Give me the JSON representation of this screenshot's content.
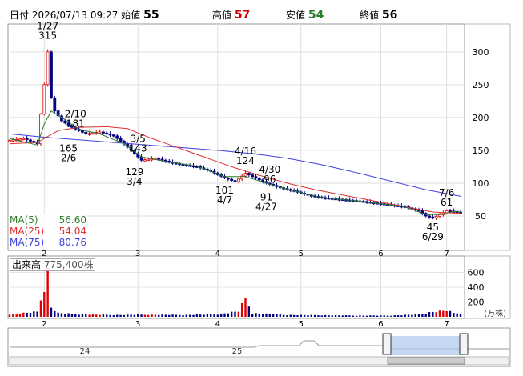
{
  "header": {
    "date_label": "日付",
    "date": "2026/07/13 09:27",
    "open_label": "始値",
    "open": "55",
    "high_label": "高値",
    "high": "57",
    "low_label": "安値",
    "low": "54",
    "close_label": "終値",
    "close": "56"
  },
  "legend": [
    {
      "name": "MA(5)",
      "value": "56.60",
      "color": "#2e7d2e"
    },
    {
      "name": "MA(25)",
      "value": "54.04",
      "color": "#e03030"
    },
    {
      "name": "MA(75)",
      "value": "80.76",
      "color": "#4040e0"
    }
  ],
  "volume": {
    "label": "出来高",
    "value": "775,400株",
    "unit": "(万株)",
    "ticks": [
      "600",
      "400",
      "200"
    ]
  },
  "navigator": {
    "labels": [
      "24",
      "25"
    ]
  },
  "colors": {
    "up": "#e00000",
    "down": "#000080",
    "ma5": "#2e7d2e",
    "ma25": "#e03030",
    "ma75": "#4040e0"
  },
  "chart_data": {
    "type": "candlestick",
    "y_ticks": [
      300,
      250,
      200,
      150,
      100,
      50
    ],
    "ylim": [
      0,
      340
    ],
    "x_months": [
      "2",
      "3",
      "4",
      "5",
      "6",
      "7"
    ],
    "annotations": [
      {
        "date": "1/27",
        "value": 315,
        "kind": "high"
      },
      {
        "date": "2/10",
        "value": 181,
        "kind": "high"
      },
      {
        "date": "2/6",
        "value": 165,
        "kind": "low"
      },
      {
        "date": "3/5",
        "value": 143,
        "kind": "high"
      },
      {
        "date": "3/4",
        "value": 129,
        "kind": "low"
      },
      {
        "date": "4/16",
        "value": 124,
        "kind": "high"
      },
      {
        "date": "4/7",
        "value": 101,
        "kind": "low"
      },
      {
        "date": "4/30",
        "value": 96,
        "kind": "high"
      },
      {
        "date": "4/27",
        "value": 91,
        "kind": "low"
      },
      {
        "date": "7/6",
        "value": 61,
        "kind": "high"
      },
      {
        "date": "6/29",
        "value": 45,
        "kind": "low"
      }
    ],
    "price_path": [
      [
        0,
        165
      ],
      [
        4,
        168
      ],
      [
        8,
        160
      ],
      [
        10,
        250
      ],
      [
        11,
        300
      ],
      [
        12,
        230
      ],
      [
        13,
        210
      ],
      [
        15,
        195
      ],
      [
        18,
        185
      ],
      [
        22,
        175
      ],
      [
        26,
        178
      ],
      [
        30,
        172
      ],
      [
        33,
        160
      ],
      [
        36,
        145
      ],
      [
        38,
        135
      ],
      [
        42,
        138
      ],
      [
        46,
        132
      ],
      [
        50,
        128
      ],
      [
        54,
        125
      ],
      [
        58,
        118
      ],
      [
        62,
        108
      ],
      [
        65,
        102
      ],
      [
        68,
        115
      ],
      [
        70,
        110
      ],
      [
        74,
        100
      ],
      [
        78,
        93
      ],
      [
        82,
        88
      ],
      [
        86,
        82
      ],
      [
        90,
        78
      ],
      [
        96,
        75
      ],
      [
        102,
        72
      ],
      [
        108,
        68
      ],
      [
        114,
        64
      ],
      [
        118,
        58
      ],
      [
        120,
        50
      ],
      [
        122,
        47
      ],
      [
        124,
        52
      ],
      [
        126,
        58
      ],
      [
        128,
        57
      ],
      [
        130,
        55
      ]
    ],
    "ma5_path": [
      [
        0,
        168
      ],
      [
        8,
        158
      ],
      [
        10,
        190
      ],
      [
        12,
        210
      ],
      [
        15,
        200
      ],
      [
        20,
        182
      ],
      [
        26,
        175
      ],
      [
        33,
        160
      ],
      [
        38,
        140
      ],
      [
        46,
        132
      ],
      [
        54,
        126
      ],
      [
        62,
        110
      ],
      [
        68,
        110
      ],
      [
        74,
        100
      ],
      [
        82,
        88
      ],
      [
        90,
        78
      ],
      [
        102,
        72
      ],
      [
        114,
        64
      ],
      [
        120,
        52
      ],
      [
        124,
        52
      ],
      [
        128,
        57
      ],
      [
        130,
        56
      ]
    ],
    "ma25_path": [
      [
        0,
        160
      ],
      [
        8,
        162
      ],
      [
        14,
        180
      ],
      [
        20,
        185
      ],
      [
        28,
        186
      ],
      [
        34,
        183
      ],
      [
        40,
        170
      ],
      [
        48,
        155
      ],
      [
        56,
        140
      ],
      [
        64,
        125
      ],
      [
        72,
        112
      ],
      [
        80,
        100
      ],
      [
        88,
        90
      ],
      [
        96,
        82
      ],
      [
        104,
        74
      ],
      [
        112,
        66
      ],
      [
        118,
        60
      ],
      [
        122,
        56
      ],
      [
        126,
        55
      ],
      [
        130,
        54
      ]
    ],
    "ma75_path": [
      [
        0,
        175
      ],
      [
        10,
        170
      ],
      [
        20,
        166
      ],
      [
        30,
        162
      ],
      [
        40,
        158
      ],
      [
        50,
        154
      ],
      [
        60,
        150
      ],
      [
        70,
        145
      ],
      [
        80,
        138
      ],
      [
        90,
        128
      ],
      [
        100,
        116
      ],
      [
        110,
        103
      ],
      [
        120,
        90
      ],
      [
        126,
        84
      ],
      [
        130,
        80
      ]
    ],
    "volume_path": [
      [
        0,
        40
      ],
      [
        8,
        80
      ],
      [
        10,
        480
      ],
      [
        11,
        720
      ],
      [
        12,
        150
      ],
      [
        14,
        60
      ],
      [
        20,
        40
      ],
      [
        30,
        30
      ],
      [
        40,
        35
      ],
      [
        50,
        30
      ],
      [
        60,
        40
      ],
      [
        66,
        90
      ],
      [
        68,
        290
      ],
      [
        70,
        60
      ],
      [
        80,
        30
      ],
      [
        90,
        25
      ],
      [
        100,
        20
      ],
      [
        110,
        20
      ],
      [
        118,
        40
      ],
      [
        122,
        80
      ],
      [
        126,
        100
      ],
      [
        128,
        60
      ],
      [
        130,
        60
      ]
    ]
  }
}
